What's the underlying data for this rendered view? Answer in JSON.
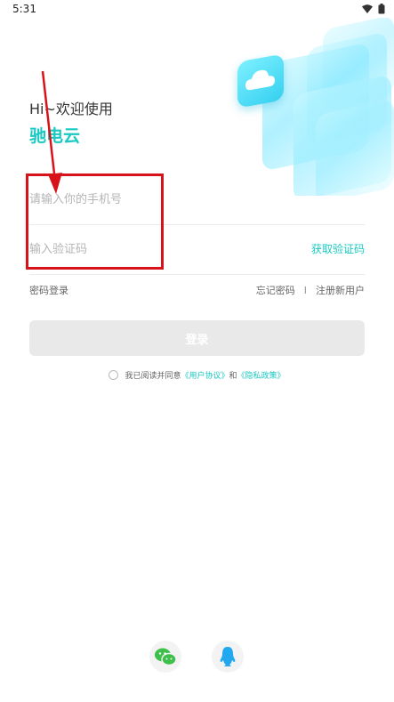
{
  "status": {
    "time": "5:31",
    "wifi_icon": "wifi-icon",
    "battery_icon": "battery-icon"
  },
  "greeting": "Hi~欢迎使用",
  "brand": "驰电云",
  "phone": {
    "placeholder": "请输入你的手机号",
    "value": ""
  },
  "code": {
    "placeholder": "输入验证码",
    "value": "",
    "get_code_label": "获取验证码"
  },
  "links": {
    "password_login": "密码登录",
    "forgot_password": "忘记密码",
    "separator": "I",
    "register": "注册新用户"
  },
  "login_button": "登录",
  "agreement": {
    "prefix": "我已阅读并同意",
    "user_agreement": "《用户协议》",
    "and": "和",
    "privacy_policy": "《隐私政策》",
    "checked": false
  },
  "social": {
    "wechat_icon": "wechat-icon",
    "qq_icon": "qq-icon"
  },
  "colors": {
    "accent": "#19c9c2",
    "annotation": "#d8121a",
    "button_disabled": "#e9e9e9"
  }
}
